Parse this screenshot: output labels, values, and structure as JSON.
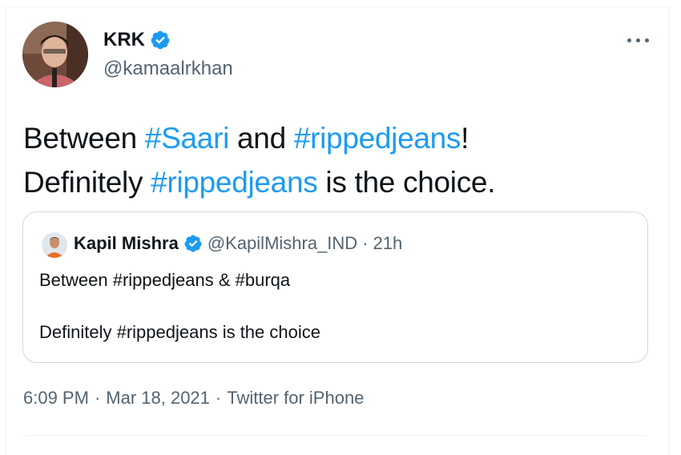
{
  "author": {
    "name": "KRK",
    "handle": "@kamaalrkhan"
  },
  "tweet": {
    "line1": {
      "pre": "Between ",
      "tag1": "#Saari",
      "mid": " and ",
      "tag2": "#rippedjeans",
      "post": "!"
    },
    "line2": {
      "pre": "Definitely ",
      "tag": "#rippedjeans",
      "post": " is the choice."
    }
  },
  "quoted": {
    "name": "Kapil Mishra",
    "handle": "@KapilMishra_IND",
    "separator": "·",
    "time": "21h",
    "line1": "Between #rippedjeans & #burqa",
    "line2": "Definitely #rippedjeans is the choice"
  },
  "meta": {
    "time": "6:09 PM",
    "separator": "·",
    "date": "Mar 18, 2021",
    "source": "Twitter for iPhone"
  },
  "colors": {
    "accent": "#1d9bf0",
    "text": "#0f1419",
    "muted": "#536471",
    "border": "#cfd9de"
  },
  "icons": [
    "verified-badge-icon",
    "more-options-icon"
  ]
}
